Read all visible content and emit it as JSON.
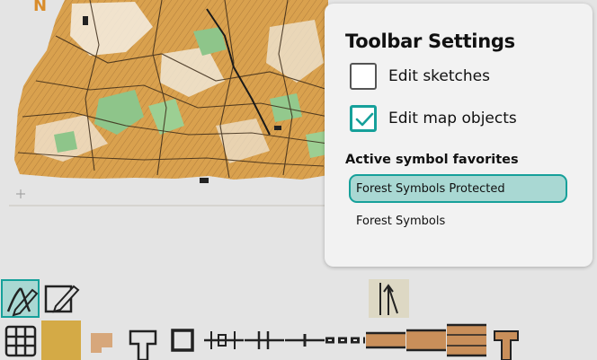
{
  "settings_panel": {
    "title": "Toolbar Settings",
    "options": [
      {
        "label": "Edit sketches",
        "checked": false
      },
      {
        "label": "Edit map objects",
        "checked": true
      }
    ],
    "favorites_heading": "Active symbol favorites",
    "favorites": [
      {
        "label": "Forest Symbols Protected",
        "selected": true
      },
      {
        "label": "Forest Symbols",
        "selected": false
      }
    ]
  },
  "map": {
    "north_label": "N"
  },
  "colors": {
    "accent": "#16a09a",
    "selected_fill": "#a9d8d3",
    "map_orange": "#d9a14e",
    "map_green": "#8ec58a",
    "swatch_yellow": "#d4aa46",
    "swatch_peach": "#d7a77b"
  },
  "toolbar": {
    "mode_tools": [
      {
        "icon": "edit-map-objects-icon",
        "active": true
      },
      {
        "icon": "edit-sketches-icon",
        "active": false
      },
      {
        "icon": "snap-to-line-icon",
        "active": true
      }
    ],
    "symbol_icons": [
      "grid-icon",
      "yellow-area-swatch-icon",
      "peach-area-swatch-icon",
      "tag-symbol-icon",
      "square-outline-icon",
      "fence-line-icon",
      "double-tick-line-icon",
      "single-tick-line-icon",
      "dashed-line-icon",
      "narrow-track-icon",
      "road-icon",
      "wide-road-icon",
      "tee-symbol-icon"
    ]
  }
}
